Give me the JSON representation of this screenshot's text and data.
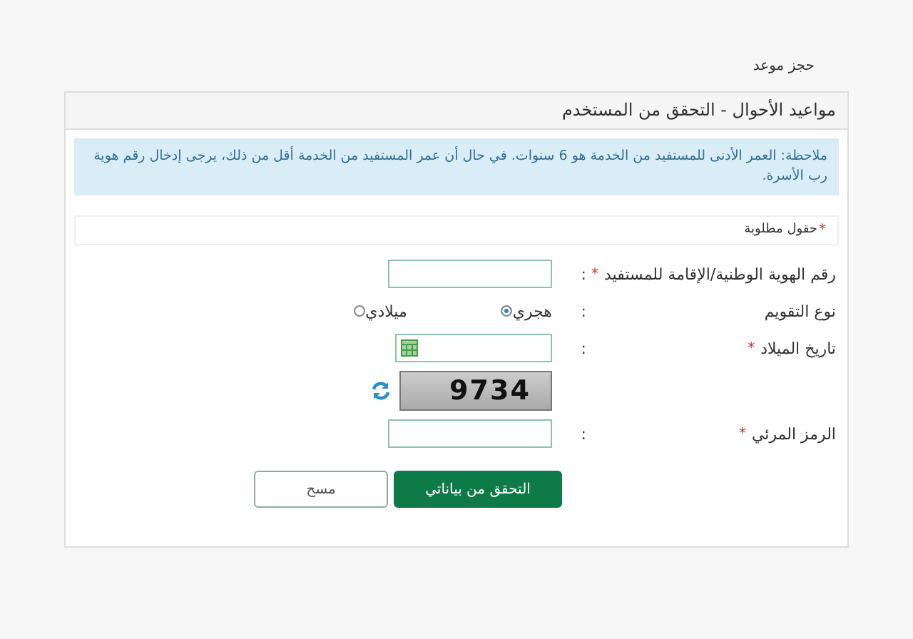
{
  "breadcrumb": "حجز موعد",
  "panel": {
    "title": "مواعيد الأحوال - التحقق من المستخدم",
    "note": "ملاحظة: العمر الأدنى للمستفيد من الخدمة هو 6 سنوات. في حال أن عمر المستفيد من الخدمة أقل من ذلك، يرجى إدخال رقم هوية رب الأسرة.",
    "required_legend": {
      "star": "*",
      "text": "حقول مطلوبة"
    },
    "fields": [
      {
        "kind": "text",
        "label": "رقم الهوية الوطنية/الإقامة للمستفيد",
        "required": true,
        "colon": ":"
      },
      {
        "kind": "radio",
        "label": "نوع التقويم",
        "colon": ":",
        "options": [
          {
            "label": "هجري",
            "selected": true
          },
          {
            "label": "ميلادي",
            "selected": false
          }
        ]
      },
      {
        "kind": "date",
        "label": "تاريخ الميلاد",
        "required": true,
        "colon": ":"
      },
      {
        "kind": "captcha",
        "code": "9734"
      },
      {
        "kind": "text",
        "label": "الرمز المرئي",
        "required": true,
        "colon": ":"
      }
    ],
    "buttons": [
      {
        "kind": "primary",
        "label": "التحقق من بياناتي"
      },
      {
        "kind": "secondary",
        "label": "مسح"
      }
    ]
  }
}
